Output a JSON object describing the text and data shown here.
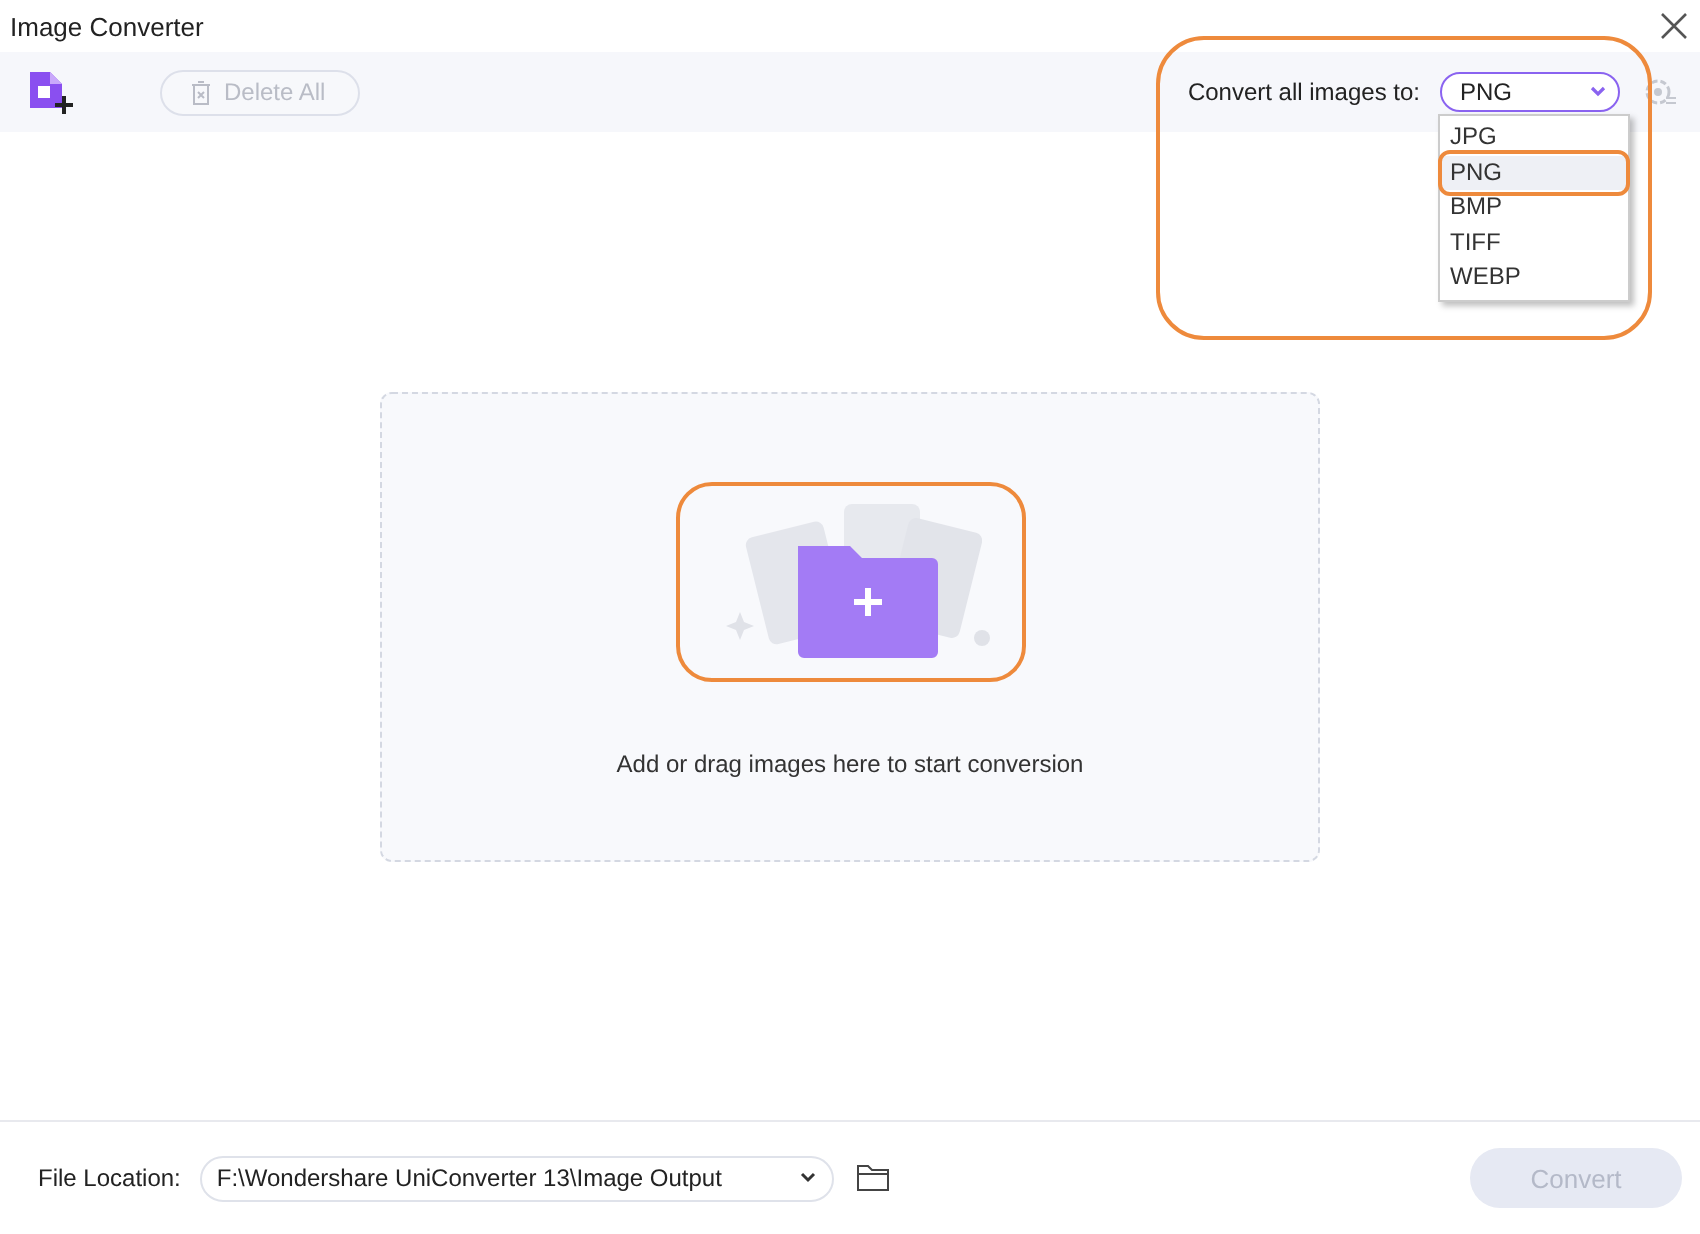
{
  "window": {
    "title": "Image Converter"
  },
  "toolbar": {
    "delete_all": {
      "label": "Delete All",
      "disabled": true
    },
    "convert_label": "Convert all images to:",
    "format_select": {
      "value": "PNG",
      "expanded": true
    },
    "format_options": [
      {
        "label": "JPG",
        "selected": false
      },
      {
        "label": "PNG",
        "selected": true
      },
      {
        "label": "BMP",
        "selected": false
      },
      {
        "label": "TIFF",
        "selected": false
      },
      {
        "label": "WEBP",
        "selected": false
      }
    ]
  },
  "drop_zone": {
    "hint": "Add or drag images here to start conversion"
  },
  "footer": {
    "file_location_label": "File Location:",
    "file_location": {
      "value": "F:\\Wondershare UniConverter 13\\Image Output"
    },
    "convert_button": {
      "label": "Convert",
      "disabled": true
    }
  }
}
